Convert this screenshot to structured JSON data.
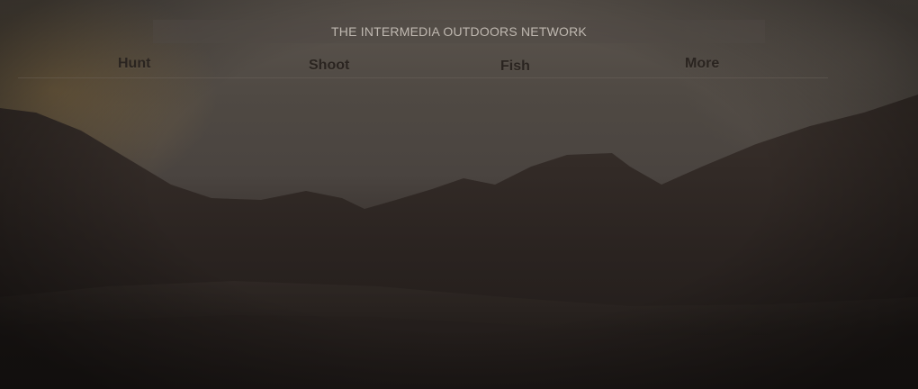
{
  "header": {
    "network_title": "THE INTERMEDIA OUTDOORS NETWORK"
  },
  "nav": {
    "items": [
      {
        "label": "Hunt"
      },
      {
        "label": "Shoot"
      },
      {
        "label": "Fish"
      },
      {
        "label": "More"
      }
    ]
  },
  "colors": {
    "sky": "#4f4943",
    "mountains": "#2b2421",
    "nav_text": "#2a2420",
    "title_text": "#bfb8b0"
  }
}
